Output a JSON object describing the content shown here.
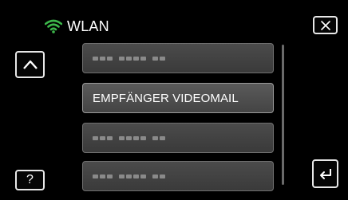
{
  "header": {
    "title": "WLAN",
    "icon": "wifi-icon"
  },
  "buttons": {
    "close": {
      "icon": "close-icon"
    },
    "up": {
      "icon": "chevron-up-icon"
    },
    "help": {
      "label": "?"
    },
    "back": {
      "icon": "return-icon"
    }
  },
  "list": {
    "items": [
      {
        "label": "",
        "masked": true
      },
      {
        "label": "EMPFÄNGER VIDEOMAIL",
        "masked": false,
        "selected": true
      },
      {
        "label": "",
        "masked": true
      },
      {
        "label": "",
        "masked": true
      }
    ]
  },
  "colors": {
    "accent_wifi": "#3cb64a",
    "background": "#000000"
  }
}
